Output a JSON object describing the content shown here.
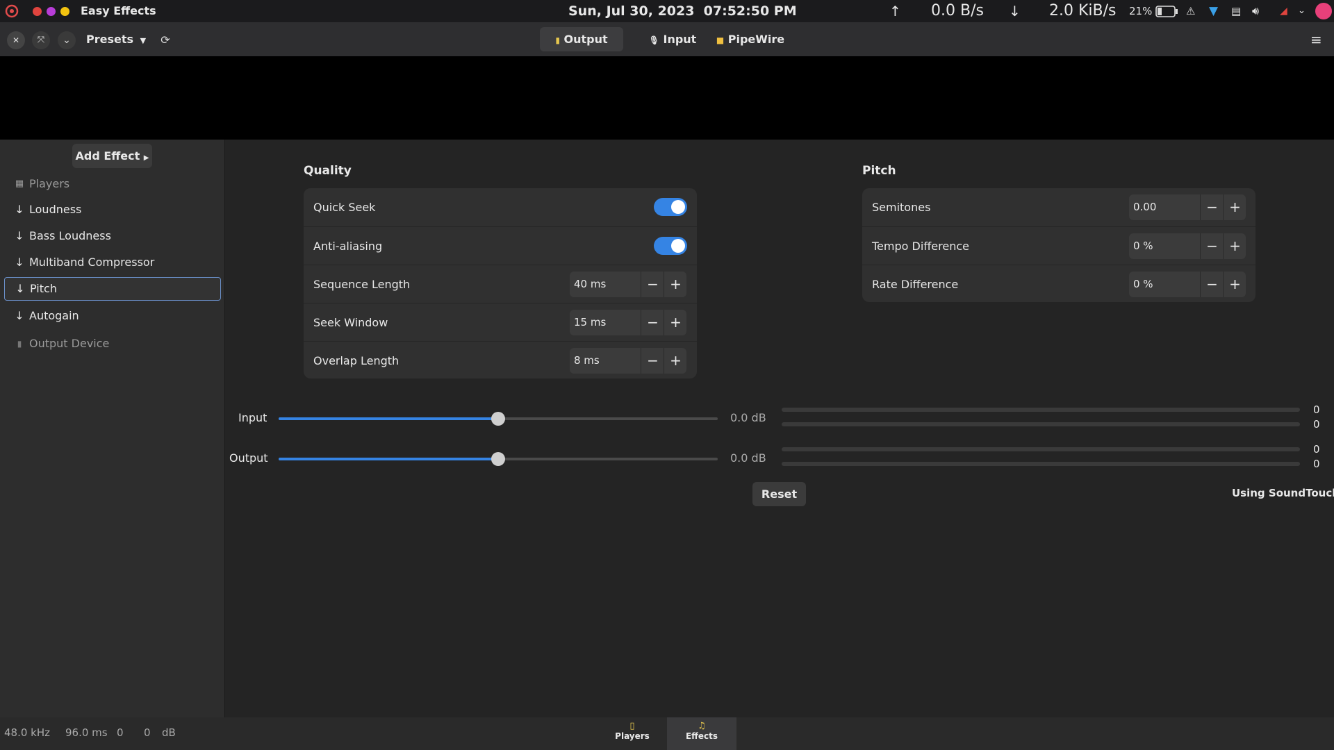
{
  "system_bar": {
    "app_name": "Easy Effects",
    "datetime": "Sun, Jul 30, 2023  07:52:50 PM",
    "upload_rate": "0.0 B/s",
    "download_rate": "2.0 KiB/s",
    "battery": "21%",
    "dot_colors": [
      "#e0443e",
      "#b83dd8",
      "#f3c310"
    ]
  },
  "header": {
    "presets_label": "Presets",
    "tabs": [
      {
        "label": "Output",
        "icon": "speaker-icon",
        "active": true
      },
      {
        "label": "Input",
        "icon": "microphone-icon",
        "active": false
      },
      {
        "label": "PipeWire",
        "icon": "pipewire-icon",
        "active": false
      }
    ]
  },
  "sidebar": {
    "add_effect_label": "Add Effect",
    "items": [
      {
        "label": "Players",
        "kind": "source"
      },
      {
        "label": "Loudness",
        "kind": "effect"
      },
      {
        "label": "Bass Loudness",
        "kind": "effect"
      },
      {
        "label": "Multiband Compressor",
        "kind": "effect"
      },
      {
        "label": "Pitch",
        "kind": "effect",
        "selected": true
      },
      {
        "label": "Autogain",
        "kind": "effect"
      },
      {
        "label": "Output Device",
        "kind": "sink"
      }
    ]
  },
  "quality": {
    "title": "Quality",
    "quick_seek": {
      "label": "Quick Seek",
      "enabled": true
    },
    "anti_aliasing": {
      "label": "Anti-aliasing",
      "enabled": true
    },
    "sequence_length": {
      "label": "Sequence Length",
      "value": "40 ms"
    },
    "seek_window": {
      "label": "Seek Window",
      "value": "15 ms"
    },
    "overlap_length": {
      "label": "Overlap Length",
      "value": "8 ms"
    }
  },
  "pitch": {
    "title": "Pitch",
    "semitones": {
      "label": "Semitones",
      "value": "0.00"
    },
    "tempo_difference": {
      "label": "Tempo Difference",
      "value": "0 %"
    },
    "rate_difference": {
      "label": "Rate Difference",
      "value": "0 %"
    }
  },
  "levels": {
    "input": {
      "label": "Input",
      "value": "0.0 dB",
      "level_fraction": 0.5,
      "meters": [
        "0",
        "0"
      ]
    },
    "output": {
      "label": "Output",
      "value": "0.0 dB",
      "level_fraction": 0.5,
      "meters": [
        "0",
        "0"
      ]
    }
  },
  "reset_label": "Reset",
  "backend_label": "Using SoundTouch",
  "status_bar": {
    "sample_rate": "48.0 kHz",
    "latency": "96.0 ms",
    "value_a": "0",
    "value_b": "0",
    "unit": "dB"
  },
  "bottom_tabs": [
    {
      "label": "Players",
      "icon": "players-icon",
      "active": false
    },
    {
      "label": "Effects",
      "icon": "music-note-icon",
      "active": true
    }
  ],
  "colors": {
    "accent": "#3584e4",
    "background": "#242424",
    "sidebar": "#2d2d2d"
  }
}
